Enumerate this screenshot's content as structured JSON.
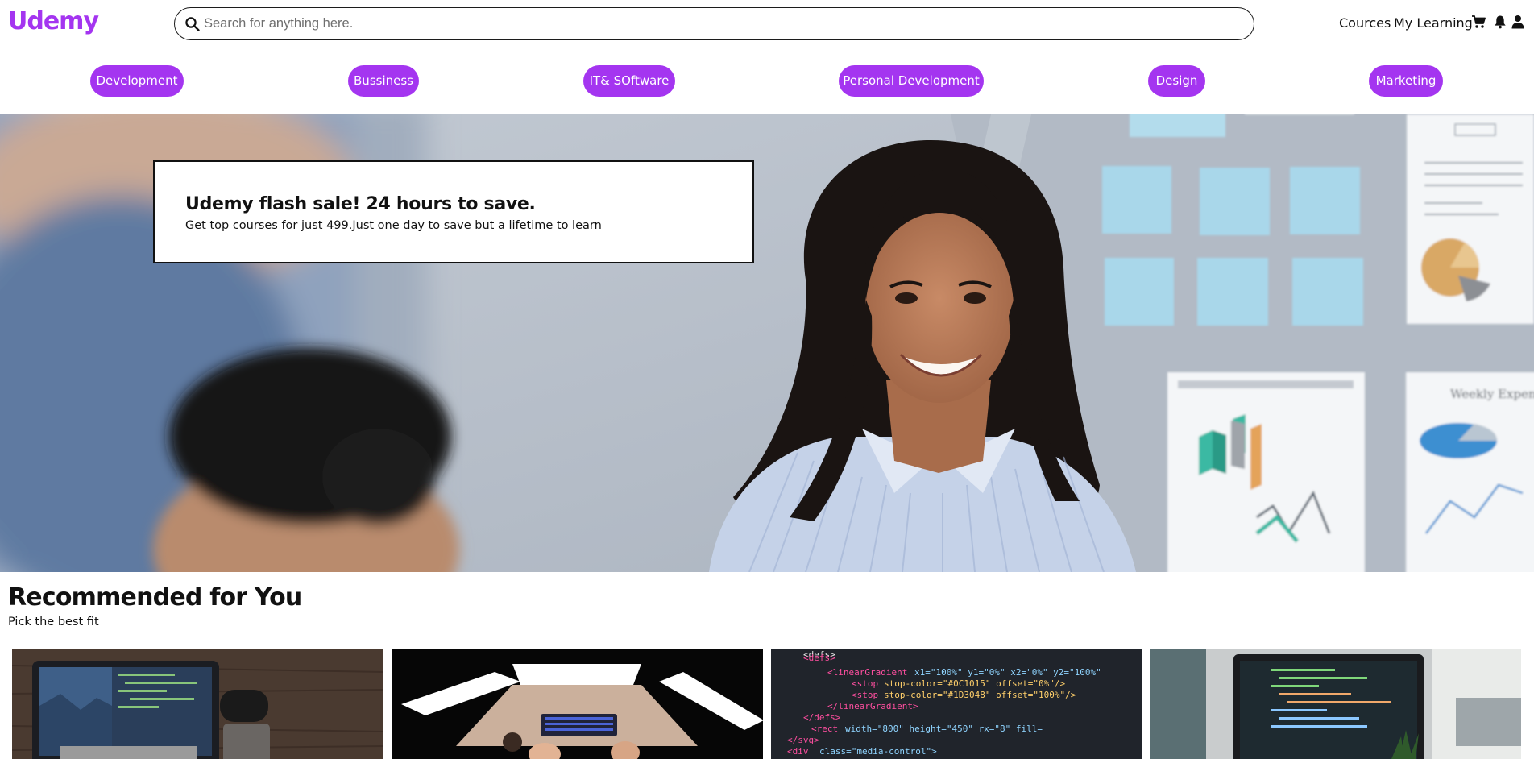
{
  "brand": {
    "name": "Udemy",
    "color": "#a435f0"
  },
  "search": {
    "placeholder": "Search for anything here.",
    "value": "",
    "icon": "search-icon"
  },
  "nav": {
    "links": [
      "Cources",
      "My Learning"
    ],
    "icons": [
      "cart-icon",
      "bell-icon",
      "user-icon"
    ]
  },
  "categories": [
    "Development",
    "Bussiness",
    "IT& SOftware",
    "Personal Development",
    "Design",
    "Marketing"
  ],
  "category_pill_color": "#a435f0",
  "hero": {
    "title": "Udemy flash sale! 24 hours to save.",
    "subtitle": "Get top courses for just 499.Just one day to save but a lifetime to learn",
    "image": "smiling woman in office with charts on wall"
  },
  "recommended": {
    "title": "Recommended for You",
    "subtitle": "Pick the best fit",
    "courses": [
      {
        "image": "laptop with code on wooden desk"
      },
      {
        "image": "overhead desk with three monitors"
      },
      {
        "image": "svg code on dark editor"
      },
      {
        "image": "laptop with code by window"
      }
    ]
  }
}
